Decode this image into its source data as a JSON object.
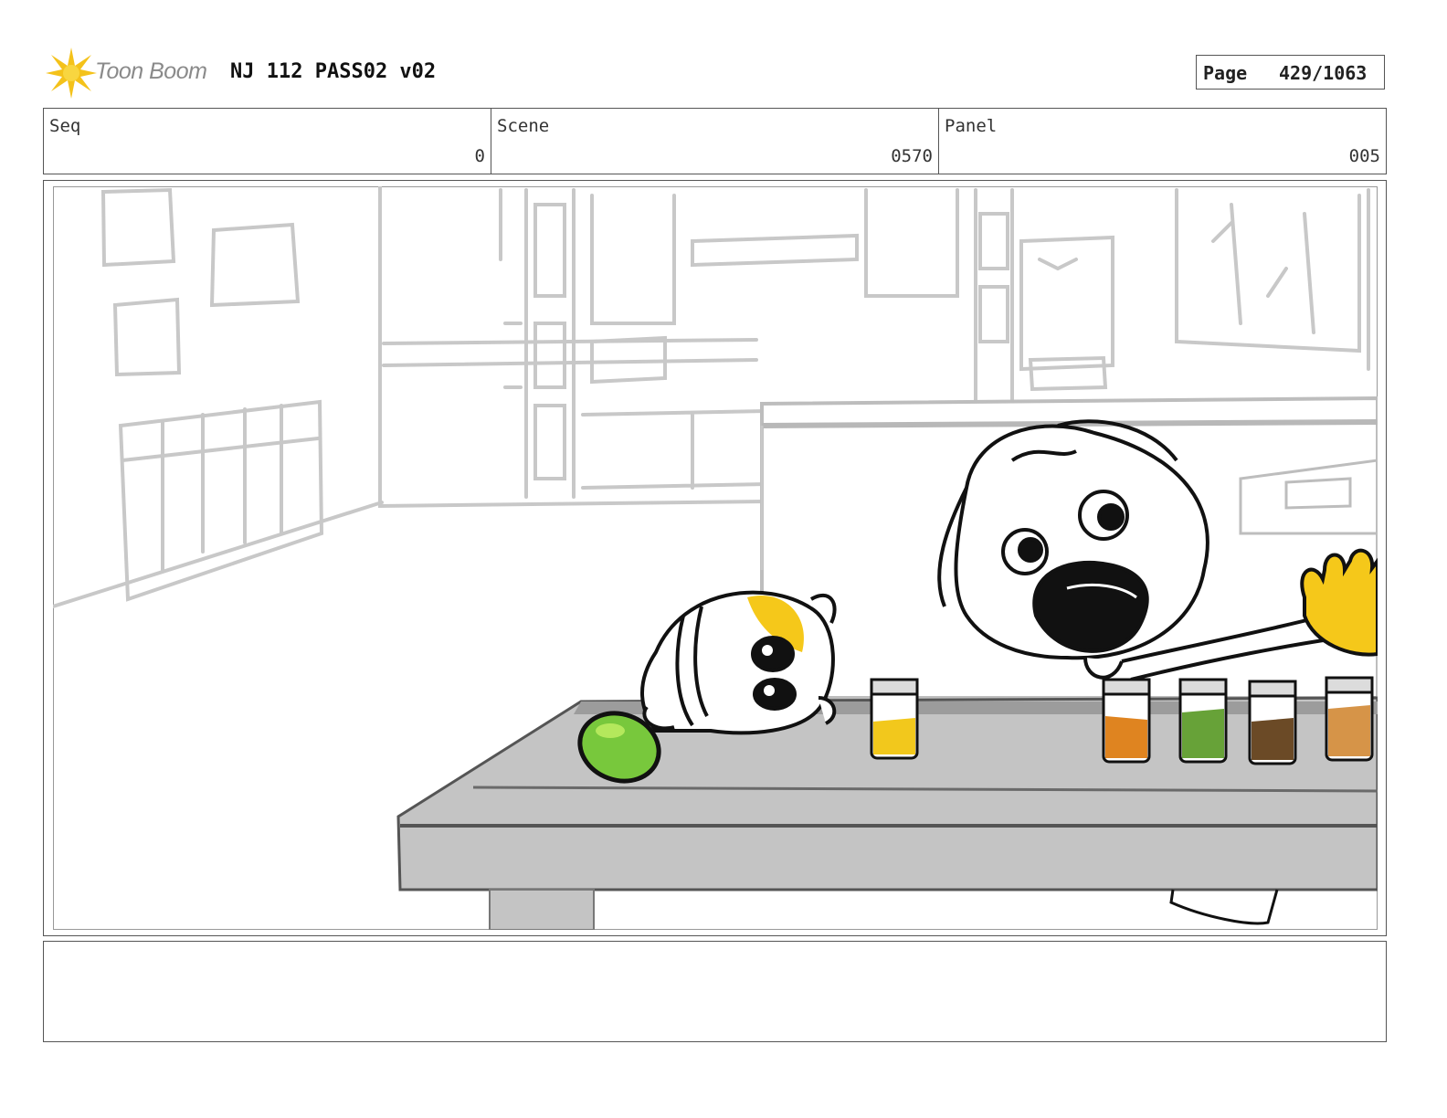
{
  "header": {
    "logo_text": "Toon Boom",
    "title": "NJ 112 PASS02 v02",
    "page_label": "Page",
    "page_value": "429/1063"
  },
  "info": {
    "seq_label": "Seq",
    "seq_value": "0",
    "scene_label": "Scene",
    "scene_value": "0570",
    "panel_label": "Panel",
    "panel_value": "005"
  },
  "notes": {
    "text": ""
  },
  "colors": {
    "logo_star": "#f4c21a",
    "table": "#c4c4c4",
    "lime": "#78c83c",
    "jar_yellow": "#f2c81c",
    "jar_orange": "#df8420",
    "jar_green": "#67a238",
    "jar_brown": "#6b4a26",
    "jar_tan": "#d69448",
    "glove": "#f5c81a"
  }
}
